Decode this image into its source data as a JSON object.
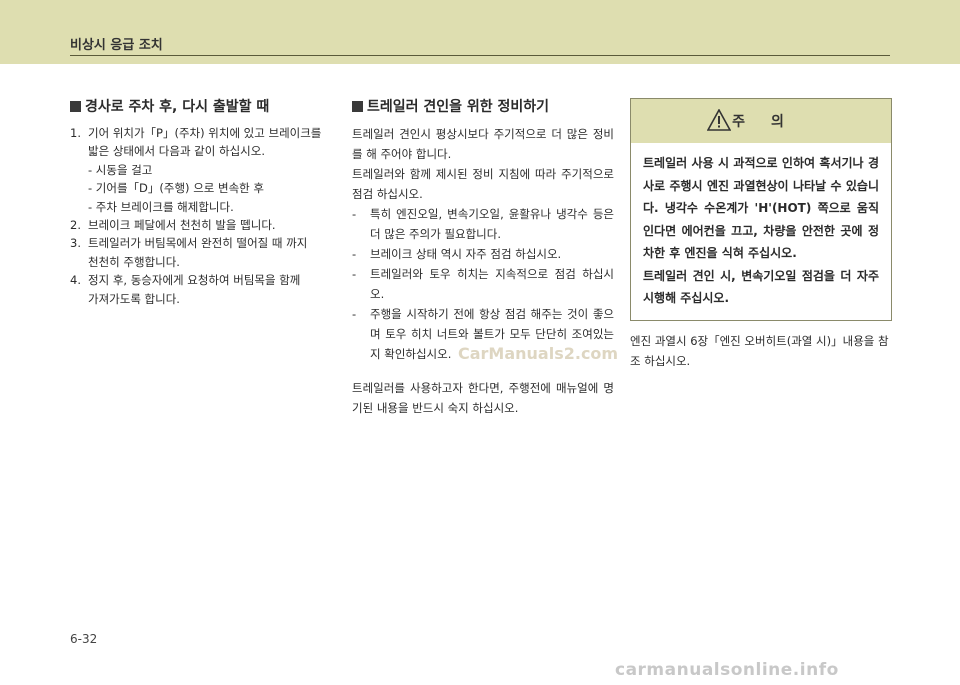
{
  "header": {
    "title": "비상시 응급 조치"
  },
  "section1": {
    "heading": "경사로 주차 후, 다시 출발할 때",
    "items": [
      {
        "num": "1.",
        "lines": [
          "기어 위치가「P」(주차) 위치에 있고 브레이크를",
          "밟은 상태에서 다음과 같이 하십시오.",
          "- 시동을 걸고",
          "- 기어를「D」(주행) 으로 변속한 후",
          "- 주차 브레이크를 해제합니다."
        ]
      },
      {
        "num": "2.",
        "lines": [
          "브레이크 페달에서 천천히 발을 뗍니다."
        ]
      },
      {
        "num": "3.",
        "lines": [
          "트레일러가 버팀목에서 완전히 떨어질 때 까지",
          "천천히 주행합니다."
        ]
      },
      {
        "num": "4.",
        "lines": [
          "정지 후, 동승자에게 요청하여 버팀목을 함께",
          "가져가도록 합니다."
        ]
      }
    ]
  },
  "section2": {
    "heading": "트레일러 견인을 위한 정비하기",
    "para1": "트레일러 견인시 평상시보다 주기적으로 더 많은 정비를 해 주어야 합니다.",
    "para2": "트레일러와 함께 제시된 정비 지침에 따라 주기적으로 점검 하십시오.",
    "bullets": [
      "특히 엔진오일, 변속기오일, 윤활유나 냉각수 등은 더 많은 주의가 필요합니다.",
      "브레이크 상태 역시 자주 점검 하십시오.",
      "트레일러와 토우 히치는 지속적으로 점검 하십시오.",
      "주행을 시작하기 전에 항상 점검 해주는 것이 좋으며 토우 히치 너트와 볼트가 모두 단단히 조여있는지 확인하십시오."
    ],
    "para3": "트레일러를 사용하고자 한다면, 주행전에 매뉴얼에 명기된 내용을 반드시 숙지 하십시오."
  },
  "caution": {
    "title": "주의",
    "text1": "트레일러 사용 시 과적으로 인하여 혹서기나 경사로 주행시 엔진 과열현상이 나타날 수 있습니다. 냉각수 수온계가 'H'(HOT) 쪽으로 움직인다면 에어컨을 끄고, 차량을 안전한 곳에 정차한 후 엔진을 식혀 주십시오.",
    "text2": "트레일러 견인 시, 변속기오일 점검을 더 자주 시행해 주십시오.",
    "icon": "warning-triangle-icon"
  },
  "reference": "엔진 과열시 6장「엔진 오버히트(과열 시)」내용을 참조 하십시오.",
  "watermark": "CarManuals2.com",
  "footer_watermark": "carmanualsonline.info",
  "page_number": "6-32"
}
